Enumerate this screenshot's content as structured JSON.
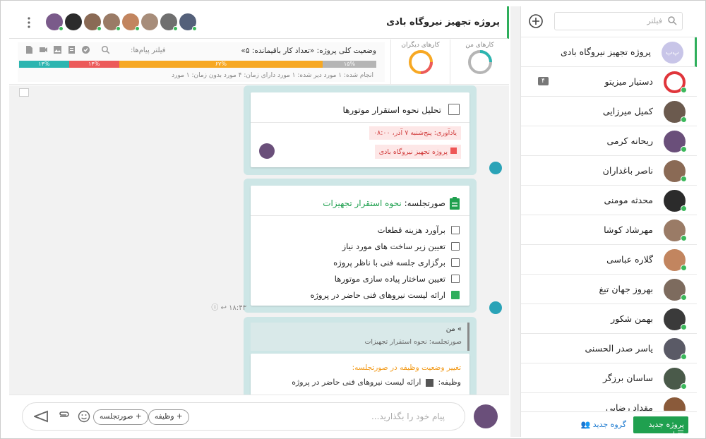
{
  "sidebar": {
    "search_placeholder": "فیلتر",
    "items": [
      {
        "name": "پروژه تجهیز نیروگاه بادی",
        "initials": "پ‌ب",
        "type": "project",
        "active": true
      },
      {
        "name": "دستیار میزیتو",
        "type": "bot",
        "badge": "۴"
      },
      {
        "name": "کمیل میرزایی"
      },
      {
        "name": "ریحانه کرمی"
      },
      {
        "name": "ناصر باغداران"
      },
      {
        "name": "محدثه مومنی"
      },
      {
        "name": "مهرشاد کوشا"
      },
      {
        "name": "گلاره عباسی"
      },
      {
        "name": "بهروز جهان تیغ"
      },
      {
        "name": "بهمن شکور"
      },
      {
        "name": "یاسر صدر الحسنی"
      },
      {
        "name": "ساسان برزگر"
      },
      {
        "name": "مقداد رضایی"
      }
    ],
    "new_project_label": "پروژه جدید",
    "new_group_label": "گروه جدید"
  },
  "header": {
    "project_title": "پروژه تجهیز نیروگاه بادی"
  },
  "status": {
    "title": "وضعیت کلی پروژه: «تعداد کار باقیمانده: ۵»",
    "filter_label": "فیلتر پیام‌ها:",
    "segments": [
      {
        "label": "۱۴%",
        "value": 14,
        "color": "#2cb5b0"
      },
      {
        "label": "۱۴%",
        "value": 14,
        "color": "#ec5a5a"
      },
      {
        "label": "۶۷%",
        "value": 57,
        "color": "#f7a823"
      },
      {
        "label": "۱۵%",
        "value": 15,
        "color": "#b5b5b5"
      }
    ],
    "legend": "انجام شده: ۱ مورد   دیر شده: ۱ مورد   دارای زمان: ۴ مورد   بدون زمان: ۱ مورد",
    "my_tasks_label": "کارهای من",
    "others_tasks_label": "کارهای دیگران"
  },
  "messages": {
    "task_title": "تحلیل نحوه استقرار موتورها",
    "reminder": "یادآوری: پنج‌شنبه ۷ آذر، ۰۸:۰۰",
    "project_tag": "پروژه تجهیز نیروگاه بادی",
    "minutes_prefix": "صورتجلسه:",
    "minutes_title": "نحوه استقرار تجهیزات",
    "checklist": [
      {
        "text": "برآورد هزینه قطعات",
        "done": false
      },
      {
        "text": "تعیین زیر ساخت های مورد نیاز",
        "done": false
      },
      {
        "text": "برگزاری جلسه فنی با ناظر پروژه",
        "done": false
      },
      {
        "text": "تعیین ساختار پیاده سازی موتورها",
        "done": false
      },
      {
        "text": "ارائه لیست نیروهای فنی حاضر در پروژه",
        "done": true
      }
    ],
    "time": "۱۸:۴۳",
    "reply_from": "» من",
    "reply_quote": "صورتجلسه: نحوه استقرار تجهیزات",
    "change_title": "تغییر وضعیت وظیفه در صورتجلسه:",
    "task_prefix": "وظیفه:",
    "changed_task": "ارائه لیست نیروهای فنی حاضر در پروژه"
  },
  "composer": {
    "placeholder": "پیام خود را بگذارید...",
    "chip_task": "+ وظیفه",
    "chip_minutes": "+ صورتجلسه"
  },
  "colors": {
    "accent": "#2eae5b",
    "teal": "#2aa3b7",
    "bubble": "#cde6e6"
  }
}
